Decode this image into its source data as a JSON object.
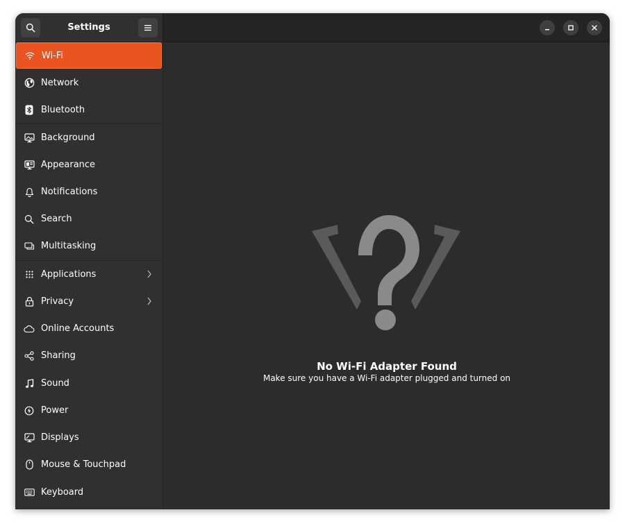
{
  "header": {
    "title": "Settings"
  },
  "sidebar": {
    "items": [
      {
        "label": "Wi-Fi",
        "icon": "wifi-icon",
        "selected": true
      },
      {
        "label": "Network",
        "icon": "globe-icon"
      },
      {
        "label": "Bluetooth",
        "icon": "bluetooth-icon"
      },
      {
        "label": "Background",
        "icon": "background-icon"
      },
      {
        "label": "Appearance",
        "icon": "appearance-icon"
      },
      {
        "label": "Notifications",
        "icon": "bell-icon"
      },
      {
        "label": "Search",
        "icon": "search-icon"
      },
      {
        "label": "Multitasking",
        "icon": "multitasking-icon"
      },
      {
        "label": "Applications",
        "icon": "grid-icon",
        "has_submenu": true
      },
      {
        "label": "Privacy",
        "icon": "lock-icon",
        "has_submenu": true
      },
      {
        "label": "Online Accounts",
        "icon": "cloud-icon"
      },
      {
        "label": "Sharing",
        "icon": "share-icon"
      },
      {
        "label": "Sound",
        "icon": "music-note-icon"
      },
      {
        "label": "Power",
        "icon": "power-icon"
      },
      {
        "label": "Displays",
        "icon": "display-icon"
      },
      {
        "label": "Mouse & Touchpad",
        "icon": "mouse-icon"
      },
      {
        "label": "Keyboard",
        "icon": "keyboard-icon"
      }
    ]
  },
  "main": {
    "status_title": "No Wi-Fi Adapter Found",
    "status_description": "Make sure you have a Wi-Fi adapter plugged and turned on",
    "status_icon": "wifi-unknown-icon"
  },
  "colors": {
    "accent": "#e95420",
    "background": "#2c2c2c",
    "sidebar": "#303030",
    "text": "#ffffff",
    "icon_gray": "#8a8a8a"
  }
}
